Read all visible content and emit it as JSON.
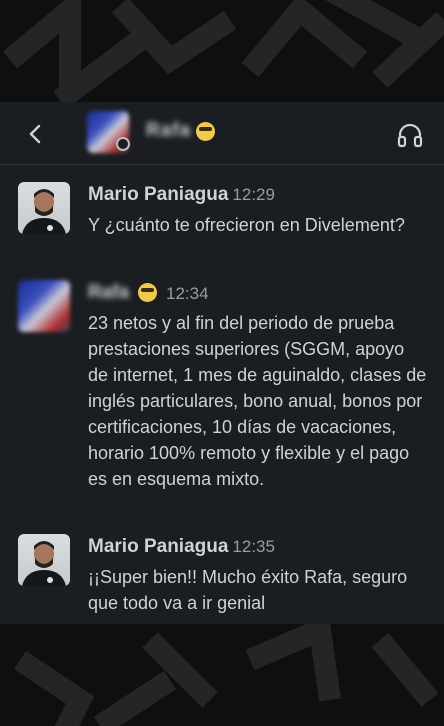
{
  "header": {
    "contact_name": "Rafa",
    "back_icon": "chevron-left-icon",
    "headphones_icon": "headphones-icon"
  },
  "messages": [
    {
      "author": "Mario Paniagua",
      "time": "12:29",
      "text": "Y ¿cuánto te ofrecieron en Divelement?"
    },
    {
      "author": "Rafa",
      "time": "12:34",
      "text": "23 netos y al fin del periodo de prueba prestaciones superiores (SGGM, apoyo de internet, 1 mes de aguinaldo, clases de inglés particulares, bono anual, bonos por certificaciones, 10 días de vacaciones, horario 100% remoto y flexible y el pago es en esquema mixto."
    },
    {
      "author": "Mario Paniagua",
      "time": "12:35",
      "text": "¡¡Super bien!! Mucho éxito Rafa, seguro que todo va a ir genial"
    }
  ],
  "colors": {
    "background": "#0e0f10",
    "panel": "#1a1d21",
    "text": "#d1d2d3",
    "timestamp": "#9a9b9d"
  }
}
